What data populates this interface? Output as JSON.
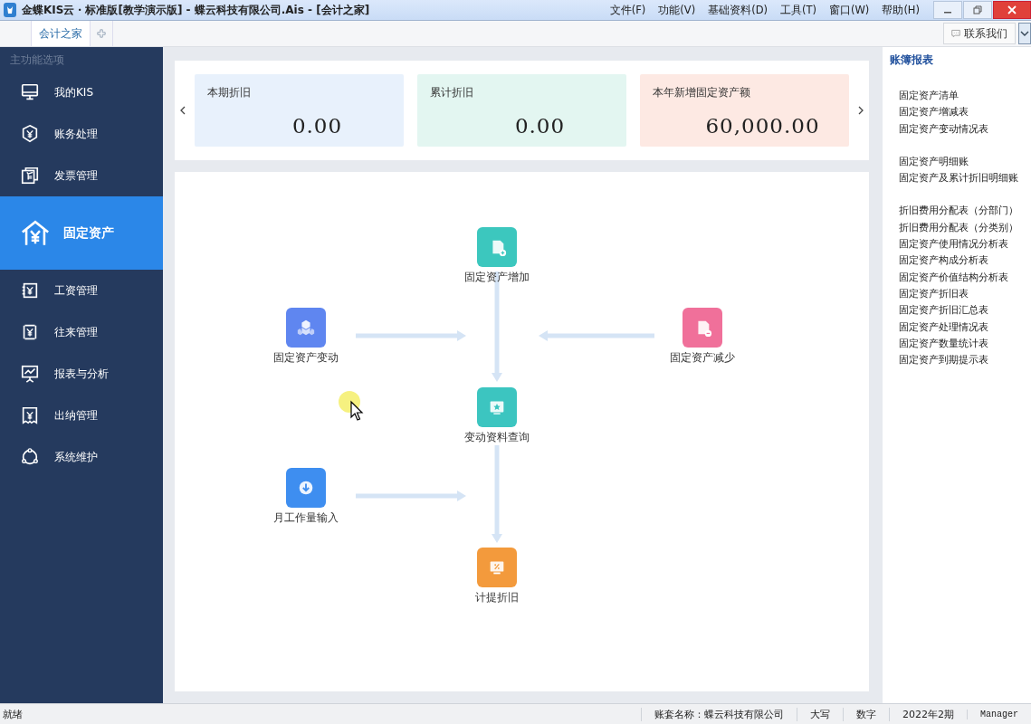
{
  "window": {
    "title": "金蝶KIS云・标准版[教学演示版] - 蝶云科技有限公司.Ais - [会计之家]"
  },
  "menu": [
    "文件(F)",
    "功能(V)",
    "基础资料(D)",
    "工具(T)",
    "窗口(W)",
    "帮助(H)"
  ],
  "tabs": [
    {
      "label": "会计之家",
      "selected": true
    }
  ],
  "contact_button": "联系我们",
  "sidebar": {
    "heading": "主功能选项",
    "items": [
      {
        "label": "我的KIS",
        "selected": false
      },
      {
        "label": "账务处理",
        "selected": false
      },
      {
        "label": "发票管理",
        "selected": false
      },
      {
        "label": "固定资产",
        "selected": true
      },
      {
        "label": "工资管理",
        "selected": false
      },
      {
        "label": "往来管理",
        "selected": false
      },
      {
        "label": "报表与分析",
        "selected": false
      },
      {
        "label": "出纳管理",
        "selected": false
      },
      {
        "label": "系统维护",
        "selected": false
      }
    ]
  },
  "summary_cards": [
    {
      "label": "本期折旧",
      "value": "0.00",
      "color": "#e8f1fc"
    },
    {
      "label": "累计折旧",
      "value": "0.00",
      "color": "#e3f6f1"
    },
    {
      "label": "本年新增固定资产额",
      "value": "60,000.00",
      "color": "#fde9e3"
    }
  ],
  "flow_nodes": [
    {
      "label": "固定资产增加",
      "color": "#3cc7be"
    },
    {
      "label": "固定资产变动",
      "color": "#5f86f0"
    },
    {
      "label": "固定资产减少",
      "color": "#f0709a"
    },
    {
      "label": "变动资料查询",
      "color": "#3cc5c0"
    },
    {
      "label": "月工作量输入",
      "color": "#3e8ef0"
    },
    {
      "label": "计提折旧",
      "color": "#f39a3c"
    }
  ],
  "reports": {
    "title": "账簿报表",
    "groups": [
      [
        "固定资产清单",
        "固定资产增减表",
        "固定资产变动情况表"
      ],
      [
        "固定资产明细账",
        "固定资产及累计折旧明细账"
      ],
      [
        "折旧费用分配表（分部门）",
        "折旧费用分配表（分类别）",
        "固定资产使用情况分析表",
        "固定资产构成分析表",
        "固定资产价值结构分析表",
        "固定资产折旧表",
        "固定资产折旧汇总表",
        "固定资产处理情况表",
        "固定资产数量统计表",
        "固定资产到期提示表"
      ]
    ]
  },
  "status_bar": [
    "就绪",
    "账套名称：蝶云科技有限公司",
    "大写",
    "数字",
    "2022年2期",
    "Manager"
  ]
}
